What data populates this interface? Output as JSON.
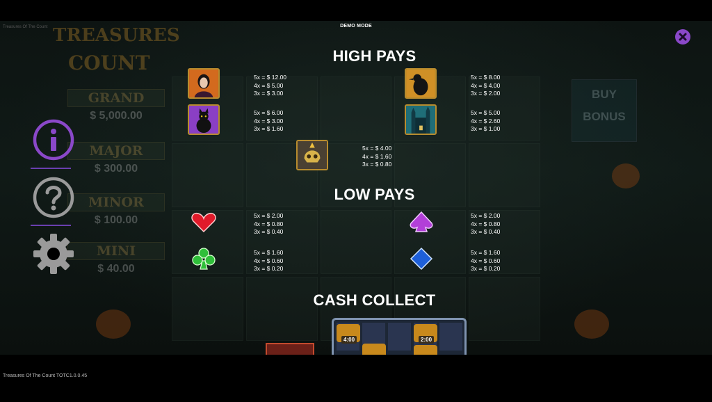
{
  "header": {
    "mode_label": "DEMO MODE",
    "game_title_small": "Treasures Of The Count"
  },
  "footer": {
    "version": "Treasures Of The Count TOTC1.0.0.45"
  },
  "background": {
    "logo_line1": "TREASURES",
    "logo_line2": "COUNT",
    "jackpots": [
      {
        "name": "GRAND",
        "value": "$ 5,000.00"
      },
      {
        "name": "MAJOR",
        "value": "$ 300.00"
      },
      {
        "name": "MINOR",
        "value": "$ 100.00"
      },
      {
        "name": "MINI",
        "value": "$ 40.00"
      }
    ],
    "buy_bonus": [
      "BUY",
      "BONUS"
    ]
  },
  "paytable": {
    "high_title": "HIGH PAYS",
    "low_title": "LOW PAYS",
    "cash_title": "CASH COLLECT",
    "high": [
      {
        "icon": "countess-icon",
        "pays": [
          "5x = $ 12.00",
          "4x = $ 5.00",
          "3x = $ 3.00"
        ]
      },
      {
        "icon": "raven-icon",
        "pays": [
          "5x = $ 8.00",
          "4x = $ 4.00",
          "3x = $ 2.00"
        ]
      },
      {
        "icon": "black-cat-icon",
        "pays": [
          "5x = $ 6.00",
          "4x = $ 3.00",
          "3x = $ 1.60"
        ]
      },
      {
        "icon": "haunted-castle-icon",
        "pays": [
          "5x = $ 5.00",
          "4x = $ 2.60",
          "3x = $ 1.00"
        ]
      },
      {
        "icon": "golden-skull-icon",
        "pays": [
          "5x = $ 4.00",
          "4x = $ 1.60",
          "3x = $ 0.80"
        ]
      }
    ],
    "low": [
      {
        "icon": "heart-icon",
        "pays": [
          "5x = $ 2.00",
          "4x = $ 0.80",
          "3x = $ 0.40"
        ]
      },
      {
        "icon": "spade-icon",
        "pays": [
          "5x = $ 2.00",
          "4x = $ 0.80",
          "3x = $ 0.40"
        ]
      },
      {
        "icon": "club-icon",
        "pays": [
          "5x = $ 1.60",
          "4x = $ 0.60",
          "3x = $ 0.20"
        ]
      },
      {
        "icon": "diamond-icon",
        "pays": [
          "5x = $ 1.60",
          "4x = $ 0.60",
          "3x = $ 0.20"
        ]
      }
    ],
    "cash_collect_values": [
      "4:00",
      "2:00"
    ]
  },
  "menu": {
    "info": "info-icon",
    "help": "help-icon",
    "settings": "gear-icon",
    "close": "close-icon"
  },
  "colors": {
    "accent_purple": "#8a48c9",
    "gold_frame": "#b88c2e",
    "background": "#000000"
  }
}
